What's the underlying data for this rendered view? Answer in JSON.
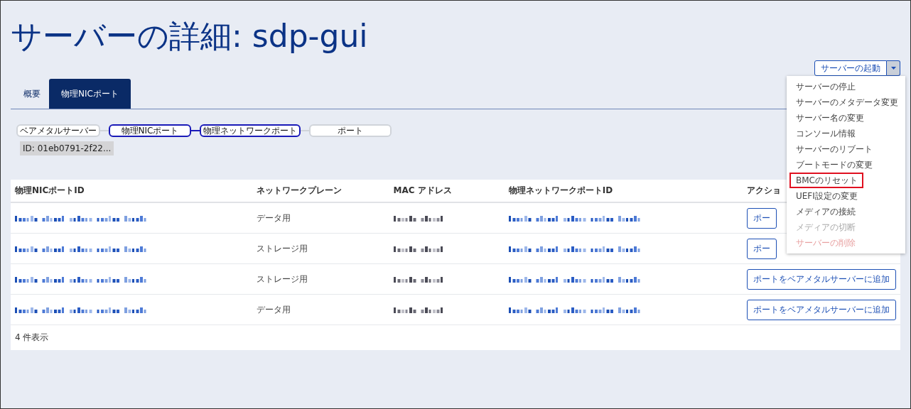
{
  "title": "サーバーの詳細: sdp-gui",
  "tabs": [
    {
      "label": "概要",
      "selected": false
    },
    {
      "label": "物理NICポート",
      "selected": true
    }
  ],
  "flow": [
    {
      "label": "ベアメタルサーバー",
      "selected": false
    },
    {
      "label": "物理NICポート",
      "selected": true
    },
    {
      "label": "物理ネットワークポート",
      "selected": true
    },
    {
      "label": "ポート",
      "selected": false
    }
  ],
  "id_chip": "ID: 01eb0791-2f22...",
  "split_button": {
    "label": "サーバーの起動",
    "expanded": true
  },
  "menu": [
    {
      "label": "サーバーの停止",
      "disabled": false,
      "highlighted": false,
      "kind": "normal"
    },
    {
      "label": "サーバーのメタデータ変更",
      "disabled": false,
      "highlighted": false,
      "kind": "normal"
    },
    {
      "label": "サーバー名の変更",
      "disabled": false,
      "highlighted": false,
      "kind": "normal"
    },
    {
      "label": "コンソール情報",
      "disabled": false,
      "highlighted": false,
      "kind": "normal"
    },
    {
      "label": "サーバーのリブート",
      "disabled": false,
      "highlighted": false,
      "kind": "normal"
    },
    {
      "label": "ブートモードの変更",
      "disabled": false,
      "highlighted": false,
      "kind": "normal"
    },
    {
      "label": "BMCのリセット",
      "disabled": false,
      "highlighted": true,
      "kind": "normal"
    },
    {
      "label": "UEFI設定の変更",
      "disabled": false,
      "highlighted": false,
      "kind": "normal"
    },
    {
      "label": "メディアの接続",
      "disabled": false,
      "highlighted": false,
      "kind": "normal"
    },
    {
      "label": "メディアの切断",
      "disabled": true,
      "highlighted": false,
      "kind": "normal"
    },
    {
      "label": "サーバーの削除",
      "disabled": true,
      "highlighted": false,
      "kind": "danger"
    }
  ],
  "table": {
    "columns": [
      {
        "label": "物理NICポートID",
        "kind": "redacted-link"
      },
      {
        "label": "ネットワークプレーン",
        "kind": "text"
      },
      {
        "label": "MAC アドレス",
        "kind": "redacted"
      },
      {
        "label": "物理ネットワークポートID",
        "kind": "redacted-link"
      },
      {
        "label": "アクショ",
        "kind": "button"
      }
    ],
    "rows": [
      [
        "",
        "データ用",
        "",
        "",
        "ポー"
      ],
      [
        "",
        "ストレージ用",
        "",
        "",
        "ポー"
      ],
      [
        "",
        "ストレージ用",
        "",
        "",
        "ポートをベアメタルサーバーに追加"
      ],
      [
        "",
        "データ用",
        "",
        "",
        "ポートをベアメタルサーバーに追加"
      ]
    ],
    "footer": "4 件表示"
  }
}
